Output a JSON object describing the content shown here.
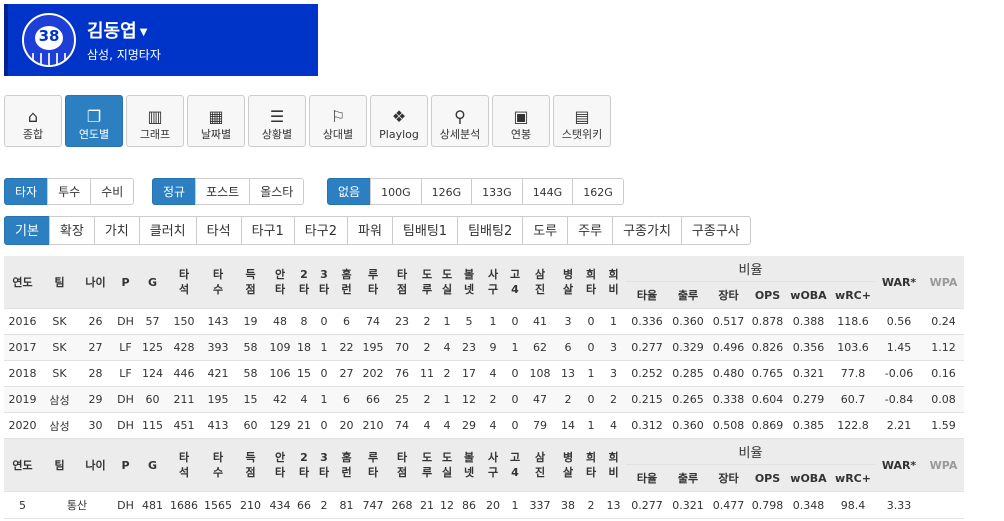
{
  "profile": {
    "number": "38",
    "name": "김동엽",
    "team_pos": "삼성, 지명타자"
  },
  "nav": [
    {
      "label": "종합",
      "icon": "home-icon",
      "glyph": "⌂"
    },
    {
      "label": "연도별",
      "icon": "copy-icon",
      "glyph": "❐"
    },
    {
      "label": "그래프",
      "icon": "bar-chart-icon",
      "glyph": "▥"
    },
    {
      "label": "날짜별",
      "icon": "calendar-icon",
      "glyph": "▦"
    },
    {
      "label": "상황별",
      "icon": "list-icon",
      "glyph": "☰"
    },
    {
      "label": "상대별",
      "icon": "flag-icon",
      "glyph": "⚐"
    },
    {
      "label": "Playlog",
      "icon": "cubes-icon",
      "glyph": "❖"
    },
    {
      "label": "상세분석",
      "icon": "search-icon",
      "glyph": "⚲"
    },
    {
      "label": "연봉",
      "icon": "money-icon",
      "glyph": "▣"
    },
    {
      "label": "스탯위키",
      "icon": "newspaper-icon",
      "glyph": "▤"
    }
  ],
  "role_tabs": [
    "타자",
    "투수",
    "수비"
  ],
  "season_tabs": [
    "정규",
    "포스트",
    "올스타"
  ],
  "game_filter": [
    "없음",
    "100G",
    "126G",
    "133G",
    "144G",
    "162G"
  ],
  "stat_tabs": [
    "기본",
    "확장",
    "가치",
    "클러치",
    "타석",
    "타구1",
    "타구2",
    "파워",
    "팀배팅1",
    "팀배팅2",
    "도루",
    "주루",
    "구종가치",
    "구종구사"
  ],
  "table": {
    "headers": [
      "연도",
      "팀",
      "나이",
      "P",
      "G",
      "타석",
      "타수",
      "득점",
      "안타",
      "2타",
      "3타",
      "홈런",
      "루타",
      "타점",
      "도루",
      "도실",
      "볼넷",
      "사구",
      "고4",
      "삼진",
      "병살",
      "희타",
      "희비"
    ],
    "ratio_header": "비율",
    "ratio_cols": [
      "타율",
      "출루",
      "장타",
      "OPS",
      "wOBA",
      "wRC+"
    ],
    "war": "WAR*",
    "wpa": "WPA",
    "rows": [
      [
        "2016",
        "SK",
        "26",
        "DH",
        "57",
        "150",
        "143",
        "19",
        "48",
        "8",
        "0",
        "6",
        "74",
        "23",
        "2",
        "1",
        "5",
        "1",
        "0",
        "41",
        "3",
        "0",
        "1",
        "0.336",
        "0.360",
        "0.517",
        "0.878",
        "0.388",
        "118.6",
        "0.56",
        "0.24"
      ],
      [
        "2017",
        "SK",
        "27",
        "LF",
        "125",
        "428",
        "393",
        "58",
        "109",
        "18",
        "1",
        "22",
        "195",
        "70",
        "2",
        "4",
        "23",
        "9",
        "1",
        "62",
        "6",
        "0",
        "3",
        "0.277",
        "0.329",
        "0.496",
        "0.826",
        "0.356",
        "103.6",
        "1.45",
        "1.12"
      ],
      [
        "2018",
        "SK",
        "28",
        "LF",
        "124",
        "446",
        "421",
        "58",
        "106",
        "15",
        "0",
        "27",
        "202",
        "76",
        "11",
        "2",
        "17",
        "4",
        "0",
        "108",
        "13",
        "1",
        "3",
        "0.252",
        "0.285",
        "0.480",
        "0.765",
        "0.321",
        "77.8",
        "-0.06",
        "0.16"
      ],
      [
        "2019",
        "삼성",
        "29",
        "DH",
        "60",
        "211",
        "195",
        "15",
        "42",
        "4",
        "1",
        "6",
        "66",
        "25",
        "2",
        "1",
        "12",
        "2",
        "0",
        "47",
        "2",
        "0",
        "2",
        "0.215",
        "0.265",
        "0.338",
        "0.604",
        "0.279",
        "60.7",
        "-0.84",
        "0.08"
      ],
      [
        "2020",
        "삼성",
        "30",
        "DH",
        "115",
        "451",
        "413",
        "60",
        "129",
        "21",
        "0",
        "20",
        "210",
        "74",
        "4",
        "4",
        "29",
        "4",
        "0",
        "79",
        "14",
        "1",
        "4",
        "0.312",
        "0.360",
        "0.508",
        "0.869",
        "0.385",
        "122.8",
        "2.21",
        "1.59"
      ]
    ],
    "total": [
      "5",
      "통산",
      "DH",
      "481",
      "1686",
      "1565",
      "210",
      "434",
      "66",
      "2",
      "81",
      "747",
      "268",
      "21",
      "12",
      "86",
      "20",
      "1",
      "337",
      "38",
      "2",
      "13",
      "0.277",
      "0.321",
      "0.477",
      "0.798",
      "0.348",
      "98.4",
      "3.33",
      ""
    ]
  }
}
